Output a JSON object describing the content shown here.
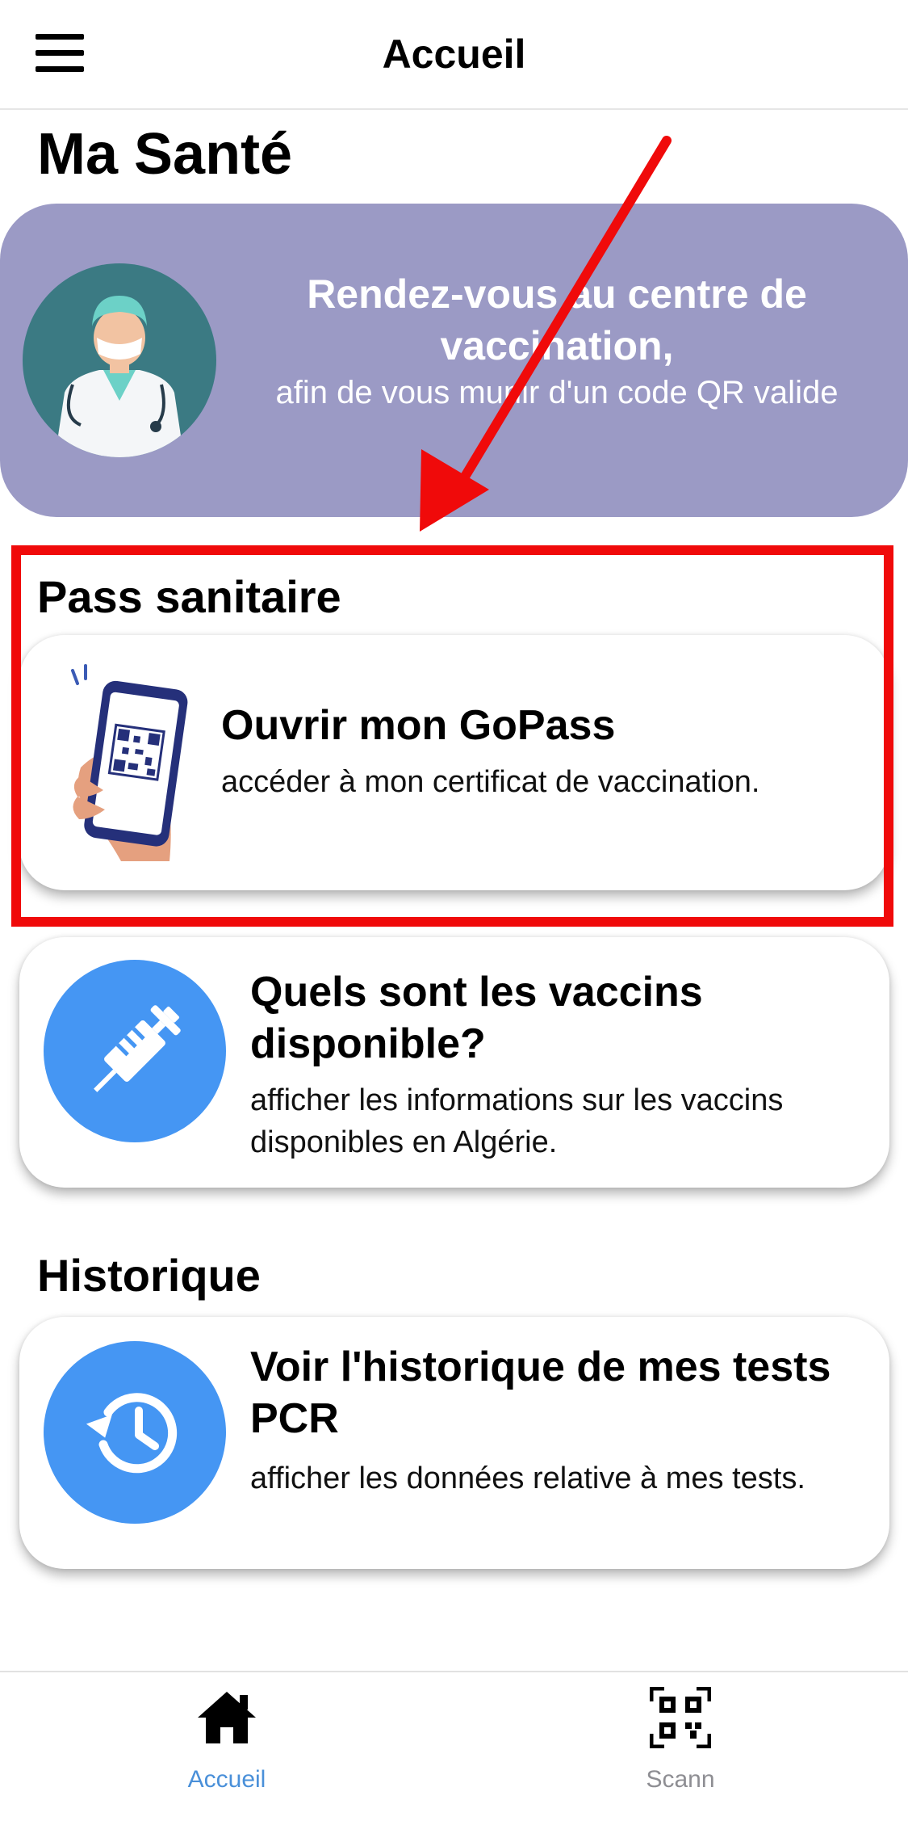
{
  "header": {
    "title": "Accueil",
    "menu_icon": "hamburger-menu-icon"
  },
  "page_title": "Ma Santé",
  "banner": {
    "title": "Rendez-vous au centre de vaccination,",
    "subtitle": "afin de vous munir d'un code QR valide",
    "avatar_icon": "doctor-avatar-icon",
    "background_color": "#9b9ac5"
  },
  "annotation": {
    "arrow_color": "#f00a0a",
    "box_color": "#f00a0a"
  },
  "pass_section": {
    "title": "Pass sanitaire",
    "gopass_card": {
      "title": "Ouvrir mon GoPass",
      "description": "accéder à mon certificat de vaccination.",
      "icon": "phone-qr-hand-icon"
    },
    "vaccines_card": {
      "title": "Quels sont les vaccins disponible?",
      "description": "afficher les informations sur les vaccins disponibles en Algérie.",
      "icon": "syringe-icon"
    }
  },
  "history_section": {
    "title": "Historique",
    "pcr_card": {
      "title": "Voir l'historique de mes tests PCR",
      "description": "afficher les données relative à mes tests.",
      "icon": "history-clock-icon"
    }
  },
  "tabbar": {
    "tabs": [
      {
        "label": "Accueil",
        "icon": "home-icon",
        "active": true
      },
      {
        "label": "Scann",
        "icon": "qr-code-scan-icon",
        "active": false
      }
    ],
    "active_color": "#4a90d9",
    "inactive_color": "#8e8e93"
  },
  "accent_color": "#4596f3"
}
